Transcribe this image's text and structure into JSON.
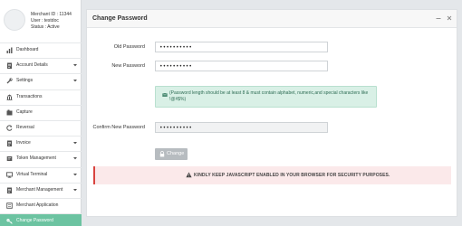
{
  "profile": {
    "merchant_id": "Merchant ID : 11344",
    "user": "User : testdoc",
    "status": "Status : Active"
  },
  "sidebar": {
    "items": [
      {
        "label": "Dashboard",
        "icon": "bar-chart-icon",
        "has_submenu": false,
        "active": false
      },
      {
        "label": "Account Details",
        "icon": "document-icon",
        "has_submenu": true,
        "active": false
      },
      {
        "label": "Settings",
        "icon": "wrench-icon",
        "has_submenu": true,
        "active": false
      },
      {
        "label": "Transactions",
        "icon": "bank-icon",
        "has_submenu": false,
        "active": false
      },
      {
        "label": "Capture",
        "icon": "capture-icon",
        "has_submenu": false,
        "active": false
      },
      {
        "label": "Reversal",
        "icon": "refresh-icon",
        "has_submenu": false,
        "active": false
      },
      {
        "label": "Invoice",
        "icon": "document-icon",
        "has_submenu": true,
        "active": false
      },
      {
        "label": "Token Management",
        "icon": "token-icon",
        "has_submenu": true,
        "active": false
      },
      {
        "label": "Virtual Terminal",
        "icon": "monitor-icon",
        "has_submenu": true,
        "active": false
      },
      {
        "label": "Merchant Management",
        "icon": "document-icon",
        "has_submenu": true,
        "active": false
      },
      {
        "label": "Merchant Application",
        "icon": "application-icon",
        "has_submenu": false,
        "active": false
      },
      {
        "label": "Change Password",
        "icon": "key-icon",
        "has_submenu": false,
        "active": true
      }
    ]
  },
  "panel": {
    "title": "Change Password",
    "old_password_label": "Old Password",
    "old_password_value": "••••••••••",
    "new_password_label": "New Password",
    "new_password_value": "••••••••••",
    "hint": "(Password length should be at least 8 & must contain alphabet, numeric,and special characters like !@#$%)",
    "confirm_password_label": "Confirm New Password",
    "confirm_password_value": "••••••••••",
    "change_button_label": "Change",
    "warning": "KINDLY KEEP JAVASCRIPT ENABLED IN YOUR BROWSER FOR SECURITY PURPOSES."
  },
  "colors": {
    "active_nav": "#6cc3a1",
    "hint_bg": "#d9f0e6",
    "warning_border": "#d9443f",
    "button_disabled": "#b7bcc0"
  }
}
